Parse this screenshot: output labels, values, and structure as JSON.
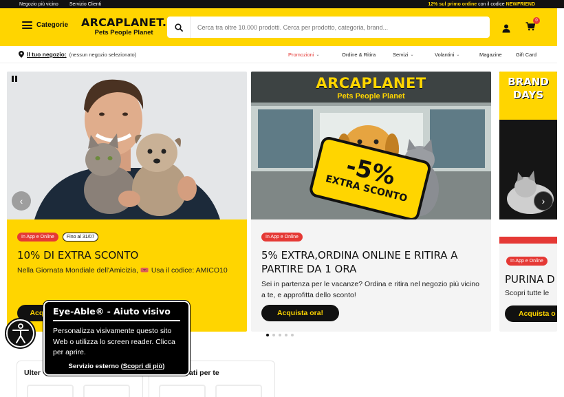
{
  "topbar": {
    "links": [
      "Negozio più vicino",
      "Servizio Clienti"
    ],
    "promo_prefix": "12% sul primo ordine",
    "promo_middle": " con il codice ",
    "promo_code": "NEWFRIEND"
  },
  "header": {
    "categories_label": "Categorie",
    "logo_line1": "ARCAPLANET.",
    "logo_line2": "Pets People Planet",
    "search_placeholder": "Cerca tra oltre 10.000 prodotti. Cerca per prodotto, categoria, brand...",
    "cart_count": "0",
    "colors": {
      "brand_yellow": "#ffd500",
      "accent_red": "#e53935",
      "dark": "#111111"
    }
  },
  "nav": {
    "store_label": "Il tuo negozio:",
    "store_value": "(nessun negozio selezionato)",
    "items": [
      {
        "label": "Promozioni",
        "has_caret": true
      },
      {
        "label": "Ordine & Ritira",
        "has_caret": false
      },
      {
        "label": "Servizi",
        "has_caret": true
      },
      {
        "label": "Volantini",
        "has_caret": true
      },
      {
        "label": "Magazine",
        "has_caret": false
      },
      {
        "label": "Gift Card",
        "has_caret": false
      }
    ]
  },
  "cards": [
    {
      "tags": [
        "In App e Online",
        "Fino al 31/07"
      ],
      "title": "10% DI EXTRA SCONTO",
      "text": "Nella Giornata Mondiale dell'Amicizia, 🎟️ Usa il codice: AMICO10",
      "button": "Acquista ora!"
    },
    {
      "tags": [
        "In App e Online"
      ],
      "title": "5% EXTRA,ORDINA ONLINE E RITIRA A PARTIRE DA 1 ORA",
      "text": "Sei in partenza per le vacanze? Ordina e ritira nel negozio più vicino a te, e approfitta dello sconto!",
      "button": "Acquista ora!",
      "image_logo1": "ARCAPLANET",
      "image_logo2": "Pets People Planet",
      "sign_percent": "-5%",
      "sign_text": "EXTRA SCONTO"
    },
    {
      "tags": [
        "In App e Online"
      ],
      "title": "PURINA D",
      "text": "Scopri tutte le",
      "button": "Acquista o",
      "image_text1": "BRAND",
      "image_text2": "DAYS"
    }
  ],
  "slider": {
    "dots": 5,
    "active": 0
  },
  "bottom": {
    "card1_title": "Ulter",
    "card2_title": "ati per te"
  },
  "eyeable": {
    "title": "Eye-Able® - Aiuto visivo",
    "text": "Personalizza visivamente questo sito Web o utilizza lo screen reader. Clicca per aprire.",
    "footer_prefix": "Servizio esterno (",
    "footer_link": "Scopri di più",
    "footer_suffix": ")"
  }
}
